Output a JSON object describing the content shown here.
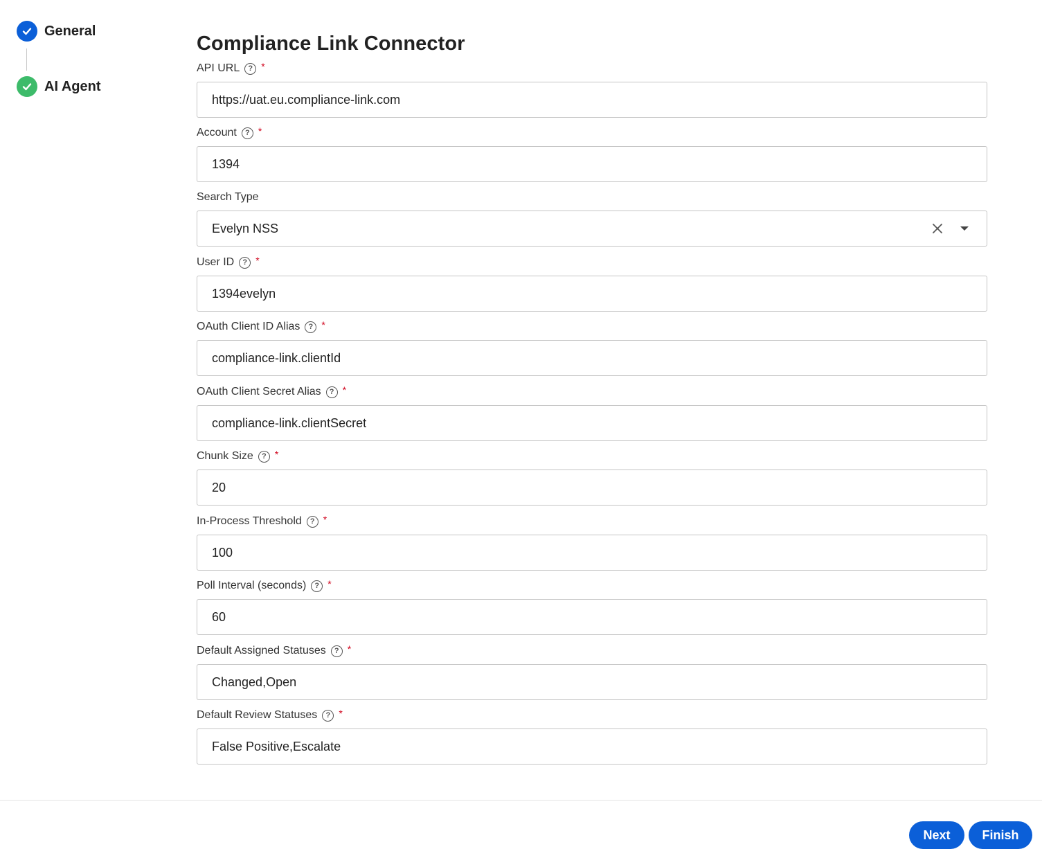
{
  "stepper": {
    "steps": [
      {
        "label": "General"
      },
      {
        "label": "AI Agent"
      }
    ]
  },
  "colors": {
    "step_general": "#0b5fd8",
    "step_ai_agent": "#3dbb6a",
    "primary": "#0b5fd8",
    "required": "#d0021b"
  },
  "form": {
    "title": "Compliance Link Connector",
    "help_glyph": "?",
    "required_glyph": "*",
    "fields": [
      {
        "label": "API URL",
        "value": "https://uat.eu.compliance-link.com"
      },
      {
        "label": "Account",
        "value": "1394"
      },
      {
        "label": "Search Type",
        "value": "Evelyn NSS"
      },
      {
        "label": "User ID",
        "value": "1394evelyn"
      },
      {
        "label": "OAuth Client ID Alias",
        "value": "compliance-link.clientId"
      },
      {
        "label": "OAuth Client Secret Alias",
        "value": "compliance-link.clientSecret"
      },
      {
        "label": "Chunk Size",
        "value": "20"
      },
      {
        "label": "In-Process Threshold",
        "value": "100"
      },
      {
        "label": "Poll Interval (seconds)",
        "value": "60"
      },
      {
        "label": "Default Assigned Statuses",
        "value": "Changed,Open"
      },
      {
        "label": "Default Review Statuses",
        "value": "False Positive,Escalate"
      }
    ]
  },
  "footer": {
    "next_label": "Next",
    "finish_label": "Finish"
  }
}
